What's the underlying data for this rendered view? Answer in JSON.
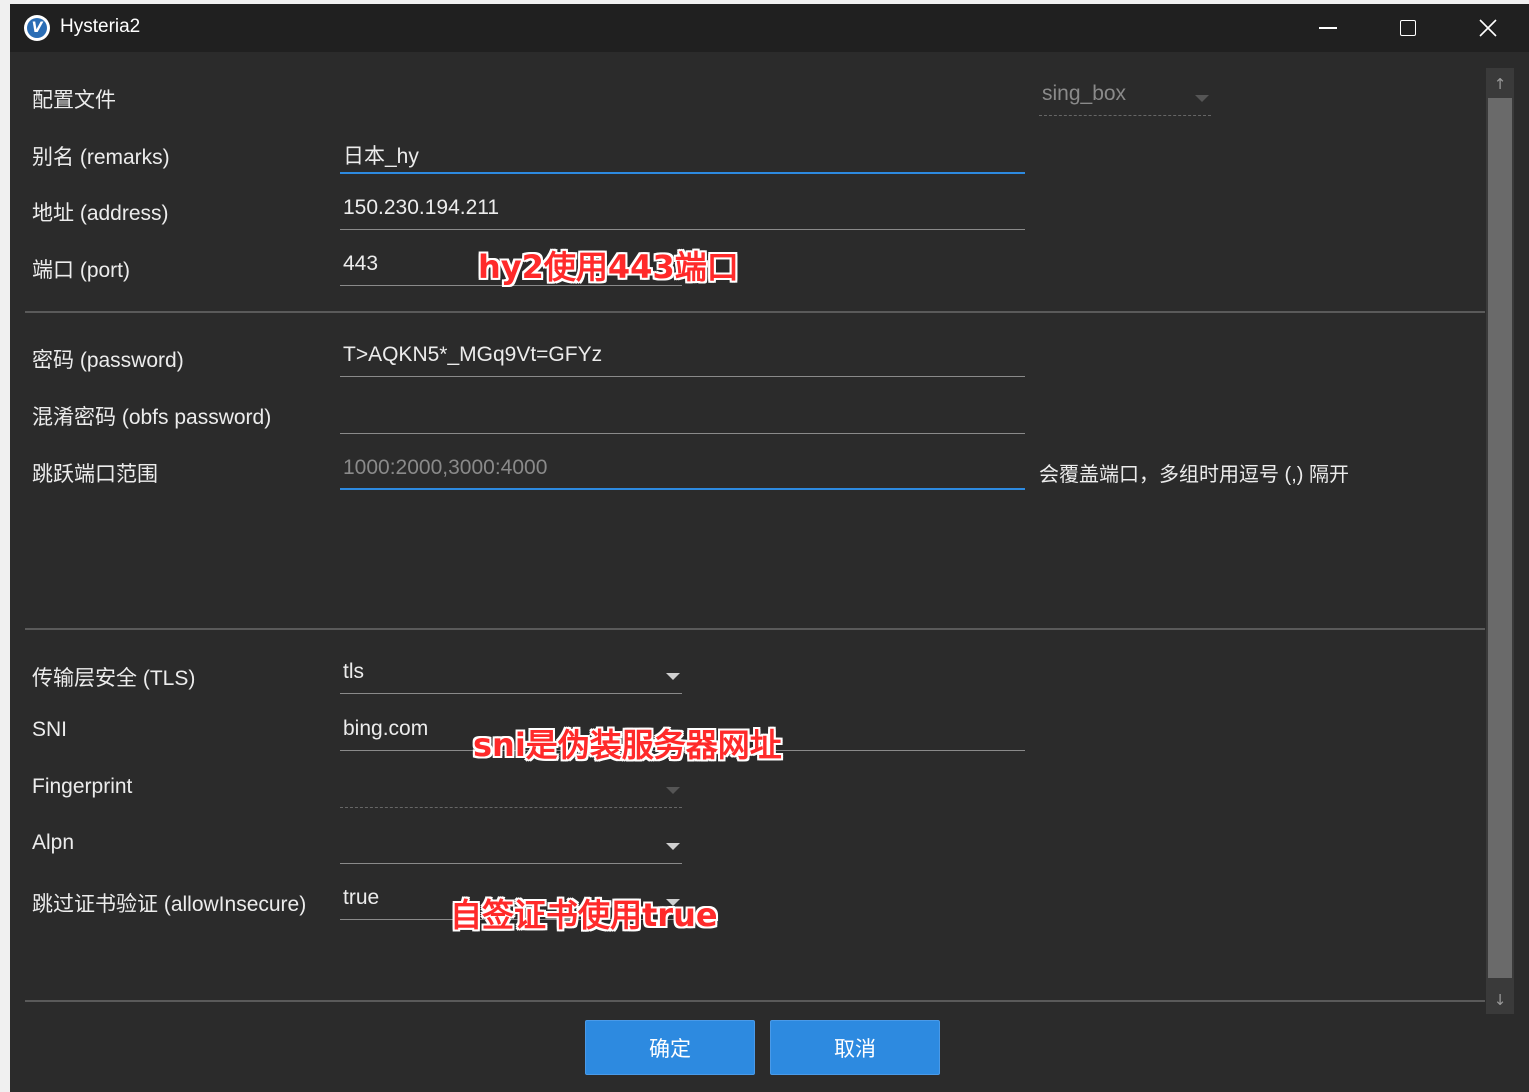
{
  "window": {
    "title": "Hysteria2",
    "logo_letter": "V"
  },
  "form": {
    "config_file": {
      "label": "配置文件",
      "value": "sing_box"
    },
    "remarks": {
      "label": "别名 (remarks)",
      "value": "日本_hy"
    },
    "address": {
      "label": "地址 (address)",
      "value": "150.230.194.211"
    },
    "port": {
      "label": "端口 (port)",
      "value": "443"
    },
    "password": {
      "label": "密码 (password)",
      "value": "T>AQKN5*_MGq9Vt=GFYz"
    },
    "obfs_password": {
      "label": "混淆密码 (obfs password)",
      "value": ""
    },
    "port_hopping": {
      "label": "跳跃端口范围",
      "placeholder": "1000:2000,3000:4000",
      "hint": "会覆盖端口，多组时用逗号 (,) 隔开"
    },
    "tls": {
      "label": "传输层安全 (TLS)",
      "value": "tls"
    },
    "sni": {
      "label": "SNI",
      "value": "bing.com"
    },
    "fingerprint": {
      "label": "Fingerprint",
      "value": ""
    },
    "alpn": {
      "label": "Alpn",
      "value": ""
    },
    "allow_insecure": {
      "label": "跳过证书验证 (allowInsecure)",
      "value": "true"
    }
  },
  "buttons": {
    "ok": "确定",
    "cancel": "取消"
  },
  "annotations": {
    "port_note": "hy2使用443端口",
    "sni_note": "sni是伪装服务器网址",
    "insecure_note": "自签证书使用true"
  },
  "colors": {
    "accent": "#2d8ae0",
    "annotation": "#ff2a2a",
    "background": "#2b2b2b"
  }
}
